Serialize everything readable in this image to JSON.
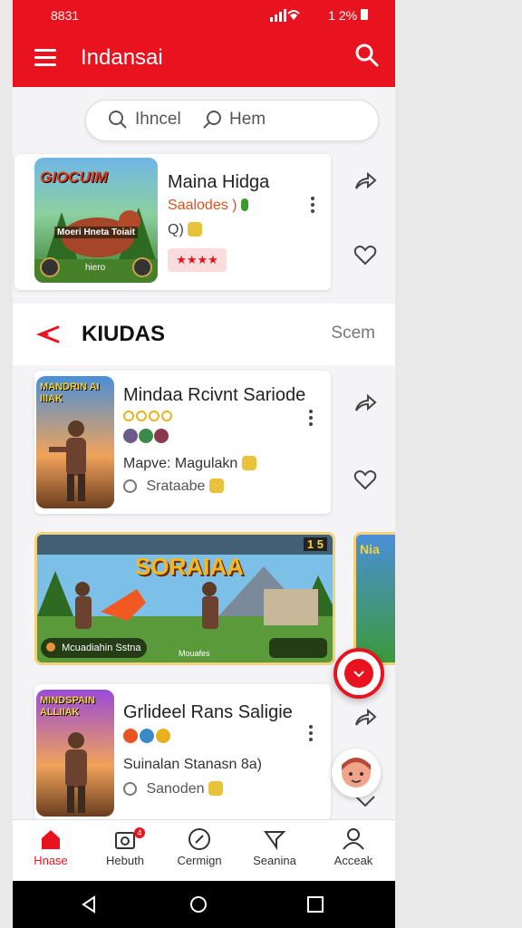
{
  "status_bar": {
    "time": "8831",
    "right": "1 2%"
  },
  "app_bar": {
    "title": "Indansai",
    "menu_icon": "menu-icon",
    "search_icon": "search-icon"
  },
  "search": {
    "left_label": "Ihncel",
    "right_label": "Hem"
  },
  "top_card": {
    "title": "Maina Hidga",
    "subtitle": "Saalodes )",
    "meta": "Q)",
    "thumb_title": "GIOCUIM",
    "thumb_caption": "Moeri Hneta Toiait",
    "thumb_label": "hiero",
    "rating": "★★★★"
  },
  "section": {
    "title": "KIUDAS",
    "more": "Scem"
  },
  "card2": {
    "title": "Mindaa Rcivnt Sariode",
    "line1": "Mapve: Magulakn",
    "line2": "Srataabe",
    "thumb_title": "MANDRIN AI IIIAK"
  },
  "banner": {
    "title": "SORAIAA",
    "caption": "Mcuadiahin Sstna",
    "tag": "Mouafes",
    "score": "1 5",
    "peek_text": "Nia"
  },
  "card3": {
    "title": "Grlideel Rans Saligie",
    "line1": "Suinalan Stanasn 8a)",
    "line2": "Sanoden",
    "thumb_title": "MINDSPAIN ALLIIAK"
  },
  "nav": [
    {
      "label": "Hnase",
      "icon": "home-icon"
    },
    {
      "label": "Hebuth",
      "icon": "camera-icon",
      "badge": "4"
    },
    {
      "label": "Cermign",
      "icon": "compass-icon"
    },
    {
      "label": "Seanina",
      "icon": "megaphone-icon"
    },
    {
      "label": "Acceak",
      "icon": "person-icon"
    }
  ],
  "colors": {
    "primary": "#e8131f",
    "background": "#f4f4f6"
  }
}
